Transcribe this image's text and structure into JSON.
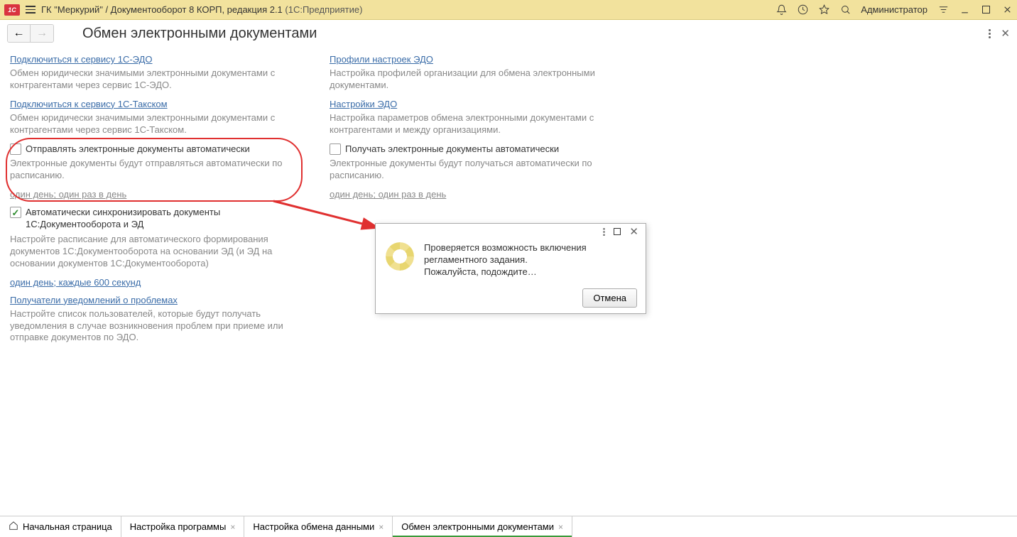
{
  "titlebar": {
    "logo": "1C",
    "title_main": "ГК \"Меркурий\" / Документооборот 8 КОРП, редакция 2.1",
    "title_sub": " (1С:Предприятие)",
    "admin": "Администратор"
  },
  "page": {
    "title": "Обмен электронными документами"
  },
  "left_col": {
    "link1": "Подключиться к сервису 1С-ЭДО",
    "desc1": "Обмен юридически значимыми электронными документами с контрагентами через сервис 1С-ЭДО.",
    "link2": "Подключиться к сервису 1С-Такском",
    "desc2": "Обмен юридически значимыми электронными документами с контрагентами через сервис 1С-Такском.",
    "chk1_label": "Отправлять электронные документы автоматически",
    "chk1_desc": "Электронные документы будут отправляться автоматически по расписанию.",
    "chk1_schedule": "один день; один раз в день",
    "chk2_label": "Автоматически синхронизировать документы 1С:Документооборота и ЭД",
    "chk2_desc": "Настройте расписание для автоматического формирования документов 1С:Документооборота на основании ЭД (и ЭД на основании документов 1С:Документооборота)",
    "chk2_schedule": "один день; каждые 600 секунд",
    "link3": "Получатели уведомлений о проблемах",
    "desc3": "Настройте список пользователей, которые будут получать уведомления в случае возникновения проблем при приеме или отправке документов по ЭДО."
  },
  "right_col": {
    "link1": "Профили настроек ЭДО",
    "desc1": "Настройка профилей организации для обмена электронными документами.",
    "link2": "Настройки ЭДО",
    "desc2": "Настройка параметров обмена электронными документами с контрагентами и между организациями.",
    "chk1_label": "Получать электронные документы автоматически",
    "chk1_desc": "Электронные документы будут получаться автоматически по расписанию.",
    "chk1_schedule": "один день; один раз в день"
  },
  "dialog": {
    "line1": "Проверяется возможность включения регламентного задания.",
    "line2": "Пожалуйста, подождите…",
    "cancel": "Отмена"
  },
  "tabs": {
    "home": "Начальная страница",
    "t1": "Настройка программы",
    "t2": "Настройка обмена данными",
    "t3": "Обмен электронными документами"
  }
}
